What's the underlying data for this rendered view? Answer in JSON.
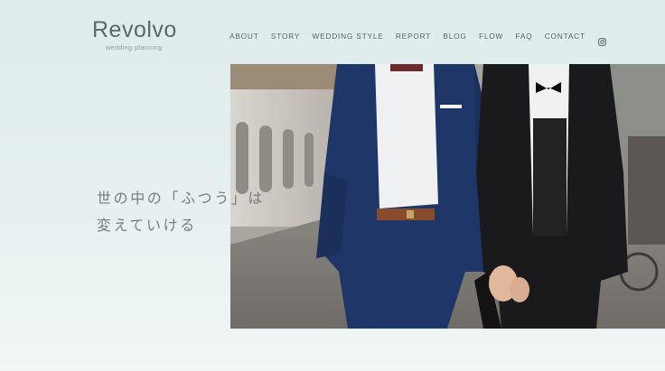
{
  "logo": {
    "main": "Revolvo",
    "sub": "wedding planning"
  },
  "nav": {
    "items": [
      "ABOUT",
      "STORY",
      "WEDDING STYLE",
      "REPORT",
      "BLOG",
      "FLOW",
      "FAQ",
      "CONTACT"
    ],
    "social_icon": "instagram-icon"
  },
  "hero": {
    "image_subject": "two grooms in suits walking hand in hand on a cobblestone street",
    "catch_lines": [
      "世の中の「ふつう」は",
      "変えていける"
    ]
  },
  "colors": {
    "background": "#dfeceb",
    "text": "#6f7779",
    "nav_text": "#59626a"
  }
}
